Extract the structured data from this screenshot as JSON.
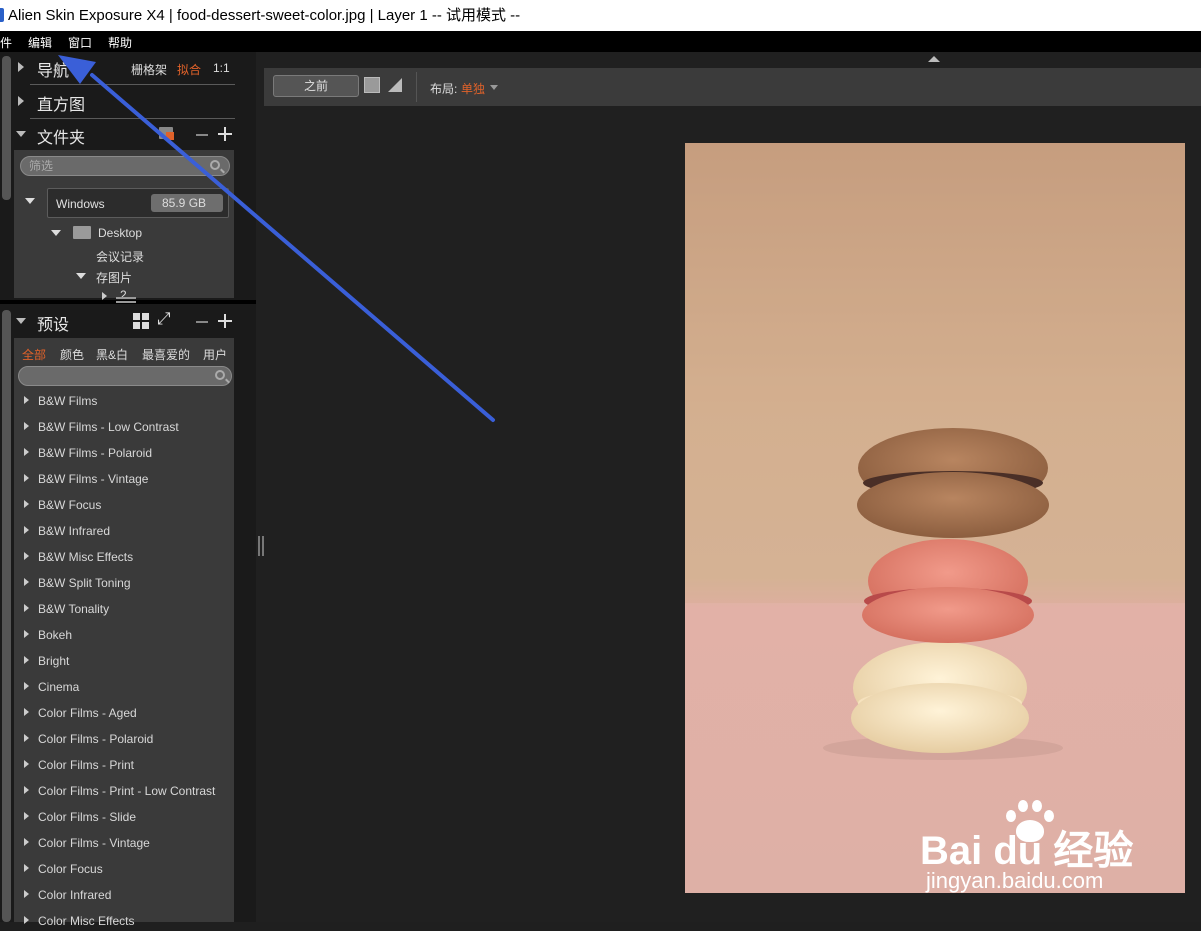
{
  "window": {
    "title": "Alien Skin Exposure X4 | food-dessert-sweet-color.jpg | Layer 1 -- 试用模式 --"
  },
  "menubar": {
    "items": [
      "件",
      "编辑",
      "窗口",
      "帮助"
    ]
  },
  "navigator": {
    "title": "导航",
    "view_grid": "栅格架",
    "view_fit": "拟合",
    "view_1to1": "1:1"
  },
  "histogram": {
    "title": "直方图"
  },
  "folders": {
    "title": "文件夹",
    "filter_placeholder": "筛选",
    "drive": {
      "name": "Windows",
      "size": "85.9 GB"
    },
    "tree": [
      {
        "label": "Desktop"
      },
      {
        "label": "会议记录"
      },
      {
        "label": "存图片"
      },
      {
        "label": "2"
      }
    ]
  },
  "presets": {
    "title": "预设",
    "filters": [
      "全部",
      "颜色",
      "黑&白",
      "最喜爱的",
      "用户"
    ],
    "active_filter": 0,
    "items": [
      "B&W Films",
      "B&W Films - Low Contrast",
      "B&W Films - Polaroid",
      "B&W Films - Vintage",
      "B&W Focus",
      "B&W Infrared",
      "B&W Misc Effects",
      "B&W Split Toning",
      "B&W Tonality",
      "Bokeh",
      "Bright",
      "Cinema",
      "Color Films - Aged",
      "Color Films - Polaroid",
      "Color Films - Print",
      "Color Films - Print - Low Contrast",
      "Color Films - Slide",
      "Color Films - Vintage",
      "Color Focus",
      "Color Infrared",
      "Color Misc Effects"
    ]
  },
  "toolbar": {
    "before_button": "之前",
    "layout_label": "布局:",
    "layout_value": "单独"
  },
  "watermark": {
    "brand": "Bai du 经验",
    "url": "jingyan.baidu.com"
  },
  "colors": {
    "accent": "#e0622a",
    "panel": "#3a3a3a",
    "background": "#1f1f1f",
    "arrow": "#3a5fd8"
  }
}
